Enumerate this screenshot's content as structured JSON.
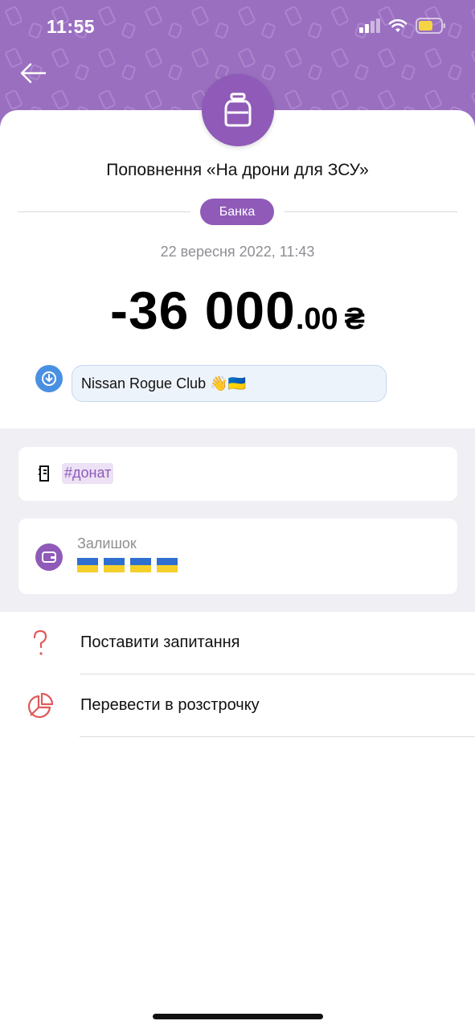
{
  "status_bar": {
    "time": "11:55"
  },
  "header": {
    "back_icon": "arrow-left-icon",
    "category_icon": "jar-icon"
  },
  "transaction": {
    "title": "Поповнення «На дрони для ЗСУ»",
    "category_badge": "Банка",
    "date": "22 вересня 2022, 11:43",
    "amount_int": "-36 000",
    "amount_dec": ".00",
    "currency": "₴",
    "comment": "Nissan Rogue Club 👋🇺🇦"
  },
  "tags": {
    "tag": "#донат"
  },
  "balance": {
    "label": "Залишок",
    "value": "🇺🇦 🇺🇦 🇺🇦 🇺🇦"
  },
  "actions": [
    {
      "label": "Поставити запитання",
      "icon": "question-icon"
    },
    {
      "label": "Перевести в розстрочку",
      "icon": "pie-chart-icon"
    }
  ],
  "colors": {
    "brand": "#8f5ab8",
    "header": "#9a6fc0",
    "accent_red": "#e05a5a",
    "comment_blue": "#4a90e2"
  }
}
